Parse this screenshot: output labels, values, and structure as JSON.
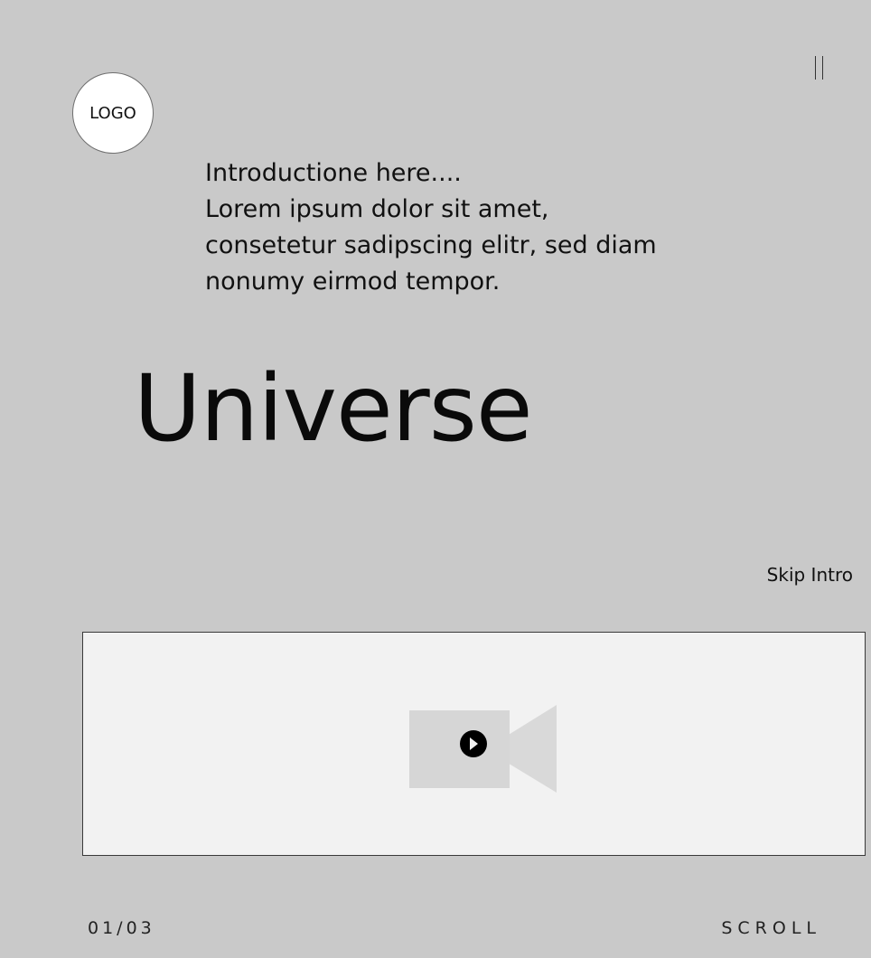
{
  "logo": {
    "label": "LOGO"
  },
  "intro": {
    "lines": [
      "Introductione here....",
      "Lorem ipsum dolor sit amet,",
      "consetetur sadipscing elitr, sed diam",
      "nonumy eirmod tempor."
    ]
  },
  "headline": "Universe",
  "skip_intro": "Skip Intro",
  "video": {
    "icon": "video-camera-icon",
    "play_icon": "play-icon"
  },
  "pause_icon": "pause-icon",
  "footer": {
    "page_counter": "01/03",
    "scroll_label": "SCROLL"
  },
  "colors": {
    "background": "#c9c9c9",
    "video_box": "#f2f2f2",
    "video_icon": "#d6d6d6",
    "play_button": "#000000"
  }
}
